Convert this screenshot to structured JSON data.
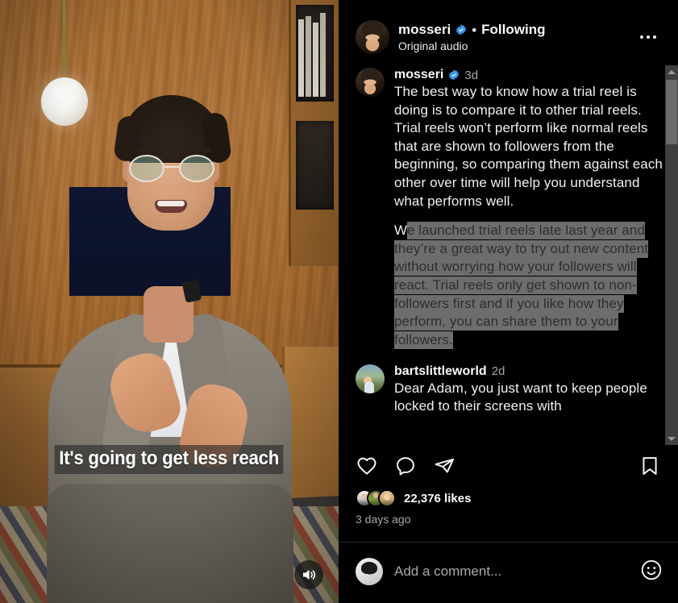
{
  "header": {
    "username": "mosseri",
    "verified_icon": "verified-badge-icon",
    "separator": "•",
    "following_label": "Following",
    "audio_label": "Original audio",
    "more_icon": "more-options-icon"
  },
  "caption": {
    "username": "mosseri",
    "time": "3d",
    "paragraph1": "The best way to know how a trial reel is doing is to compare it to other trial reels. Trial reels won’t perform like normal reels that are shown to followers from the beginning, so comparing them against each other over time will help you understand what performs well.",
    "paragraph2_prefix": "W",
    "paragraph2_selected": "e launched trial reels late last year and they’re a great way to try out new content without worrying how your followers will react. Trial reels only get shown to non-followers first and if you like how they perform, you can share them to your followers.",
    "selection_bg": "#6d6d6d",
    "selection_fg": "#2e2e2e"
  },
  "comments": [
    {
      "username": "bartslittleworld",
      "time": "2d",
      "text": "Dear Adam, you just want to keep people locked to their screens with"
    }
  ],
  "scrollbar": {
    "up_icon": "scroll-up-arrow-icon",
    "down_icon": "scroll-down-arrow-icon",
    "thumb": "scrollbar-thumb"
  },
  "actions": {
    "like_icon": "heart-icon",
    "comment_icon": "comment-bubble-icon",
    "share_icon": "share-paper-plane-icon",
    "save_icon": "bookmark-icon"
  },
  "likes": {
    "count_label": "22,376 likes",
    "timestamp": "3 days ago"
  },
  "add_comment": {
    "placeholder": "Add a comment...",
    "value": "",
    "emoji_icon": "emoji-smiley-icon"
  },
  "video": {
    "subtitle": "It's going to get less reach",
    "audio_icon": "speaker-on-icon"
  },
  "colors": {
    "background": "#000000",
    "text_primary": "#fafafa",
    "text_secondary": "#a8a8a8",
    "verified_blue": "#3897f0",
    "scrollbar_track": "#3f3f3f",
    "scrollbar_thumb": "#6b6b6b"
  }
}
